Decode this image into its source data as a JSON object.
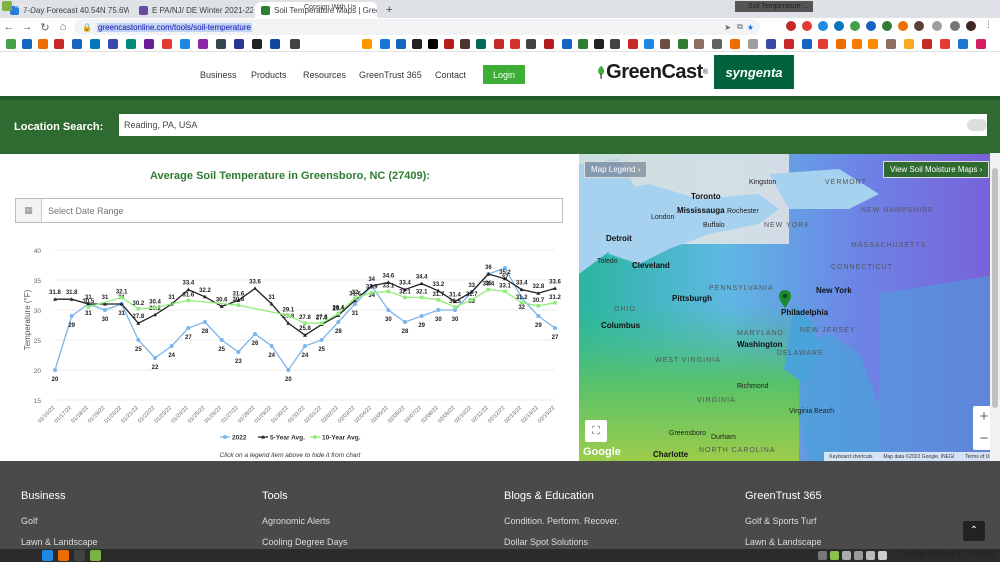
{
  "browser": {
    "tabs": [
      {
        "title": "7-Day Forecast 40.54N 75.6W",
        "favicon_color": "#2a7ae2"
      },
      {
        "title": "E PA/NJ/ DE Winter 2021-22 O",
        "favicon_color": "#6a4a9c"
      },
      {
        "title": "Soil Temperature Maps | Gree",
        "favicon_color": "#2e7d32"
      }
    ],
    "url": "greencastonline.com/tools/soil-temperature",
    "bookmark_label": "Consign With Us"
  },
  "site": {
    "nav": [
      "Business",
      "Products",
      "Resources",
      "GreenTrust 365",
      "Contact"
    ],
    "login_label": "Login",
    "logo_text": "GreenCast",
    "logo_reg": "®",
    "partner_logo": "syngenta",
    "location_label": "Location Search:",
    "location_value": "Reading, PA, USA"
  },
  "chart_section": {
    "title": "Average Soil Temperature in Greensboro, NC (27409):",
    "date_placeholder": "Select Date Range",
    "hint": "Click on a legend item above to hide it from chart"
  },
  "chart_data": {
    "type": "line",
    "ylabel": "Temperature (°F)",
    "ylim": [
      15,
      40
    ],
    "yticks": [
      15,
      20,
      25,
      30,
      35,
      40
    ],
    "x": [
      "01/16/22",
      "01/17/22",
      "01/18/22",
      "01/19/22",
      "01/20/22",
      "01/21/22",
      "01/22/22",
      "01/23/22",
      "01/24/22",
      "01/25/22",
      "01/26/22",
      "01/27/22",
      "01/28/22",
      "01/29/22",
      "01/30/22",
      "01/31/22",
      "02/01/22",
      "02/02/22",
      "02/03/22",
      "02/04/22",
      "02/05/22",
      "02/06/22",
      "02/07/22",
      "02/08/22",
      "02/09/22",
      "02/10/22",
      "02/11/22",
      "02/12/22",
      "02/13/22",
      "02/14/22",
      "02/15/22"
    ],
    "series": [
      {
        "name": "2022",
        "color": "#7cb5ec",
        "values": [
          20,
          29,
          31,
          30,
          31,
          25,
          22,
          24,
          27,
          28,
          25,
          23,
          26,
          24,
          20,
          24,
          25,
          28,
          31,
          34,
          30,
          28,
          29,
          30,
          30,
          33,
          36,
          37,
          32,
          29,
          27
        ]
      },
      {
        "name": "5-Year Avg.",
        "color": "#222222",
        "values": [
          31.8,
          31.8,
          31,
          31,
          31,
          27.8,
          29.2,
          31,
          33.4,
          32.2,
          30.6,
          31.6,
          33.6,
          31,
          27.8,
          25.8,
          27.6,
          29.1,
          31.6,
          34,
          34.6,
          33.4,
          34.4,
          33.2,
          31.4,
          33,
          36,
          35.2,
          33.4,
          32.8,
          33.6
        ]
      },
      {
        "name": "10-Year Avg.",
        "color": "#90ed7d",
        "values": [
          null,
          null,
          30.5,
          null,
          32.1,
          30.2,
          30.4,
          null,
          31.6,
          null,
          null,
          30.8,
          null,
          null,
          29.1,
          27.8,
          27.8,
          29.4,
          32,
          32.9,
          33.1,
          32.1,
          32.1,
          31.7,
          30.5,
          31.7,
          33.4,
          33.1,
          31.2,
          30.7,
          31.2
        ]
      }
    ],
    "legend_position": "bottom-center"
  },
  "map": {
    "legend_btn": "Map Legend ›",
    "moisture_btn": "View Soil Moisture Maps ›",
    "labels": {
      "toronto": "Toronto",
      "mississauga": "Mississauga",
      "kingston": "Kingston",
      "london": "London",
      "detroit": "Detroit",
      "toledo": "Toledo",
      "cleveland": "Cleveland",
      "pittsburgh": "Pittsburgh",
      "columbus": "Columbus",
      "newyork": "New York",
      "philadelphia": "Philadelphia",
      "washington": "Washington",
      "richmond": "Richmond",
      "virginiabeach": "Virginia Beach",
      "charlotte": "Charlotte",
      "durham": "Durham",
      "greensboro": "Greensboro",
      "rochester": "Rochester",
      "buffalo": "Buffalo",
      "state_ny": "NEW YORK",
      "state_pa": "PENNSYLVANIA",
      "state_oh": "OHIO",
      "state_nj": "NEW JERSEY",
      "state_md": "MARYLAND",
      "state_de": "DELAWARE",
      "state_wv": "WEST VIRGINIA",
      "state_va": "VIRGINIA",
      "state_nc": "NORTH CAROLINA",
      "state_nh": "NEW HAMPSHIRE",
      "state_ma": "MASSACHUSETTS",
      "state_ct": "CONNECTICUT",
      "state_vt": "VERMONT"
    },
    "footer": [
      "Keyboard shortcuts",
      "Map data ©2022 Google, INEGI",
      "Terms of Use"
    ],
    "google": "Google"
  },
  "footer": {
    "columns": [
      {
        "heading": "Business",
        "links": [
          "Golf",
          "Lawn & Landscape"
        ]
      },
      {
        "heading": "Tools",
        "links": [
          "Agronomic Alerts",
          "Cooling Degree Days"
        ]
      },
      {
        "heading": "Blogs & Education",
        "links": [
          "Condition. Perform. Recover.",
          "Dollar Spot Solutions"
        ]
      },
      {
        "heading": "GreenTrust 365",
        "links": [
          "Golf & Sports Turf",
          "Lawn & Landscape"
        ]
      }
    ]
  },
  "taskbar": {
    "menu_label": "Menu",
    "task_label": "Soil Temperature ...",
    "clock": "Tuesday February 15, 5:16 PM"
  }
}
